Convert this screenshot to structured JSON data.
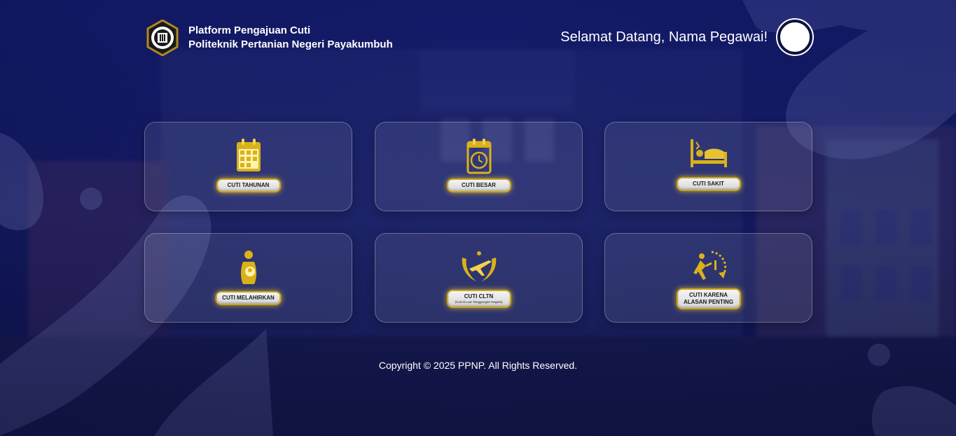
{
  "header": {
    "title_line1": "Platform Pengajuan Cuti",
    "title_line2": "Politeknik Pertanian Negeri Payakumbuh",
    "welcome": "Selamat Datang, Nama Pegawai!"
  },
  "cards": [
    {
      "label": "CUTI TAHUNAN",
      "icon": "calendar-icon"
    },
    {
      "label": "CUTI BESAR",
      "icon": "calendar-clock-icon"
    },
    {
      "label": "CUTI SAKIT",
      "icon": "sick-bed-icon"
    },
    {
      "label": "CUTI MELAHIRKAN",
      "icon": "mother-baby-icon"
    },
    {
      "label": "CUTI CLTN",
      "sublabel": "(Cuti di Luar Tanggungan Negara)",
      "icon": "winged-plane-icon"
    },
    {
      "label_line1": "CUTI KARENA",
      "label_line2": "ALASAN PENTING",
      "icon": "running-clock-icon"
    }
  ],
  "footer": {
    "copyright": "Copyright © 2025 PPNP. All Rights Reserved."
  },
  "colors": {
    "background": "#141a5e",
    "icon_gold": "#d9b21a",
    "pill_border": "#c9a41a"
  }
}
